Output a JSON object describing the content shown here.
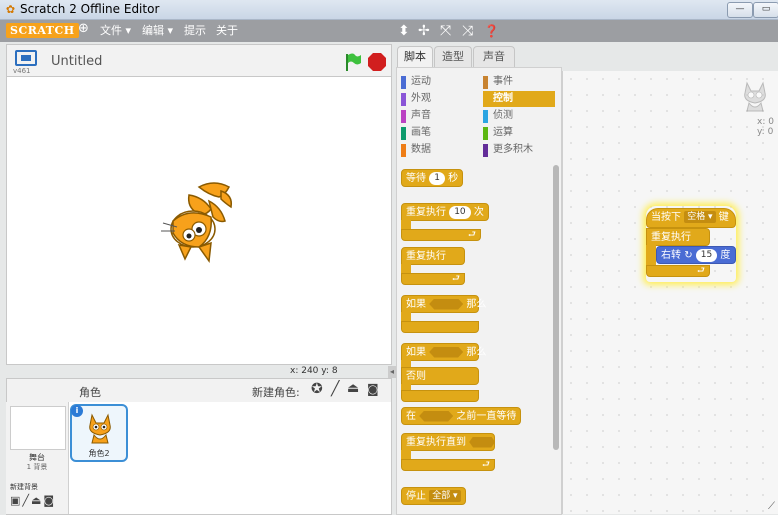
{
  "window": {
    "title": "Scratch 2 Offline Editor",
    "minimize": "—",
    "restore": "▭"
  },
  "menu": {
    "logo": "SCRATCH",
    "globe": "⊕",
    "file": "文件 ▾",
    "edit": "编辑 ▾",
    "tips": "提示",
    "about": "关于",
    "tools": {
      "stamp": "⬍",
      "cut": "✢",
      "grow": "⤧",
      "shrink": "⤨",
      "help": "❓"
    }
  },
  "stage": {
    "version": "v461",
    "project_title": "Untitled",
    "coords": "x: 240  y: 8"
  },
  "sprites": {
    "header": "角色",
    "new_sprite_label": "新建角色:",
    "stage_label": "舞台",
    "stage_sub": "1 背景",
    "new_backdrop": "新建背景",
    "sprite_name": "角色2"
  },
  "tabs": {
    "scripts": "脚本",
    "costumes": "造型",
    "sounds": "声音"
  },
  "categories": {
    "left": [
      {
        "label": "运动",
        "color": "#4a6cd4"
      },
      {
        "label": "外观",
        "color": "#8a55d7"
      },
      {
        "label": "声音",
        "color": "#bb42c3"
      },
      {
        "label": "画笔",
        "color": "#0e9a6c"
      },
      {
        "label": "数据",
        "color": "#ee7d16"
      }
    ],
    "right": [
      {
        "label": "事件",
        "color": "#c88330"
      },
      {
        "label": "控制",
        "color": "#e1a91a"
      },
      {
        "label": "侦测",
        "color": "#2ca5e2"
      },
      {
        "label": "运算",
        "color": "#5cb712"
      },
      {
        "label": "更多积木",
        "color": "#632d99"
      }
    ]
  },
  "palette": {
    "wait": "等待",
    "wait_num": "1",
    "wait_unit": "秒",
    "repeat": "重复执行",
    "repeat_num": "10",
    "repeat_unit": "次",
    "forever": "重复执行",
    "if": "如果",
    "then": "那么",
    "if2": "如果",
    "then2": "那么",
    "else": "否则",
    "wait_until": "在",
    "wait_until_suffix": "之前一直等待",
    "repeat_until": "重复执行直到",
    "stop": "停止",
    "stop_option": "全部 ▾"
  },
  "script": {
    "hat": "当按下",
    "key": "空格 ▾",
    "key_suffix": "键",
    "forever": "重复执行",
    "turn": "右转",
    "turn_icon": "↻",
    "turn_num": "15",
    "turn_unit": "度"
  },
  "sprite_info": {
    "x": "x: 0",
    "y": "y: 0"
  }
}
